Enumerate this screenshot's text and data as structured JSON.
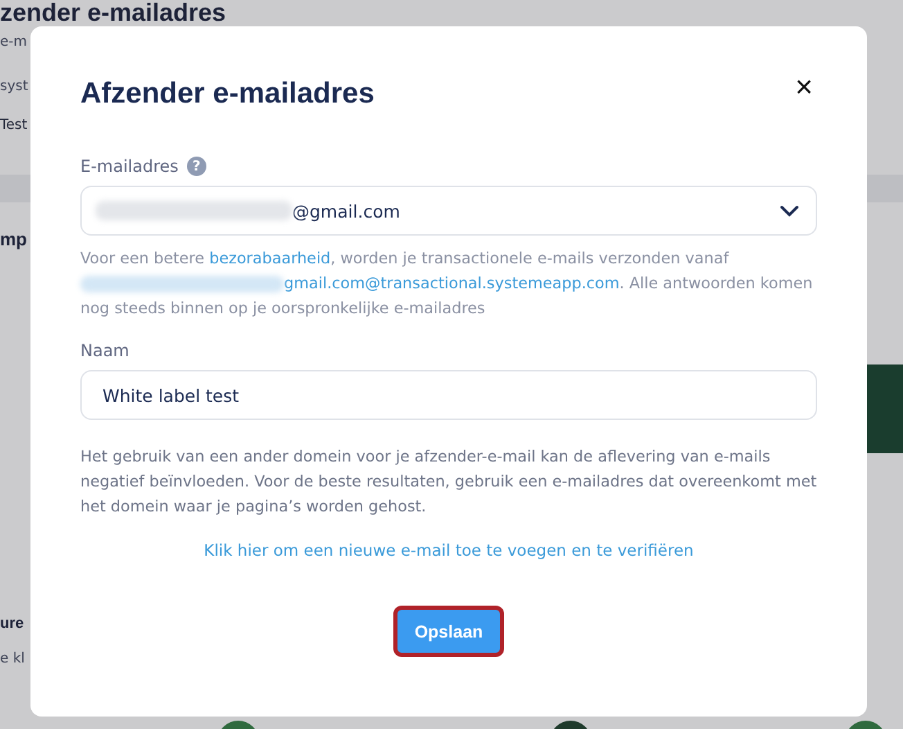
{
  "background": {
    "heading": "zender e-mailadres",
    "fragments": [
      "e-m",
      "syst",
      "Test"
    ],
    "section_heading": "mp",
    "lower_heading": "ure",
    "lower_text": "e kl"
  },
  "dialog": {
    "title": "Afzender e-mailadres",
    "close": "×",
    "email_label": "E-mailadres",
    "help": "?",
    "email_value": "@gmail.com",
    "info": {
      "before": "Voor een betere ",
      "link": "bezorabaarheid",
      "after": ", worden je transactionele e-mails verzonden vanaf",
      "address": "gmail.com@transactional.systemeapp.com",
      "rest": ". Alle antwoorden komen nog steeds binnen op je oorspronkelijke e-mailadres"
    },
    "name_label": "Naam",
    "name_value": "White label test",
    "warning": "Het gebruik van een ander domein voor je afzender-e-mail kan de aflevering van e-mails negatief beïnvloeden. Voor de beste resultaten, gebruik een e-mailadres dat overeenkomt met het domein waar je pagina’s worden gehost.",
    "add_link": "Klik hier om een nieuwe e-mail toe te voegen en te verifiëren",
    "save": "Opslaan"
  }
}
